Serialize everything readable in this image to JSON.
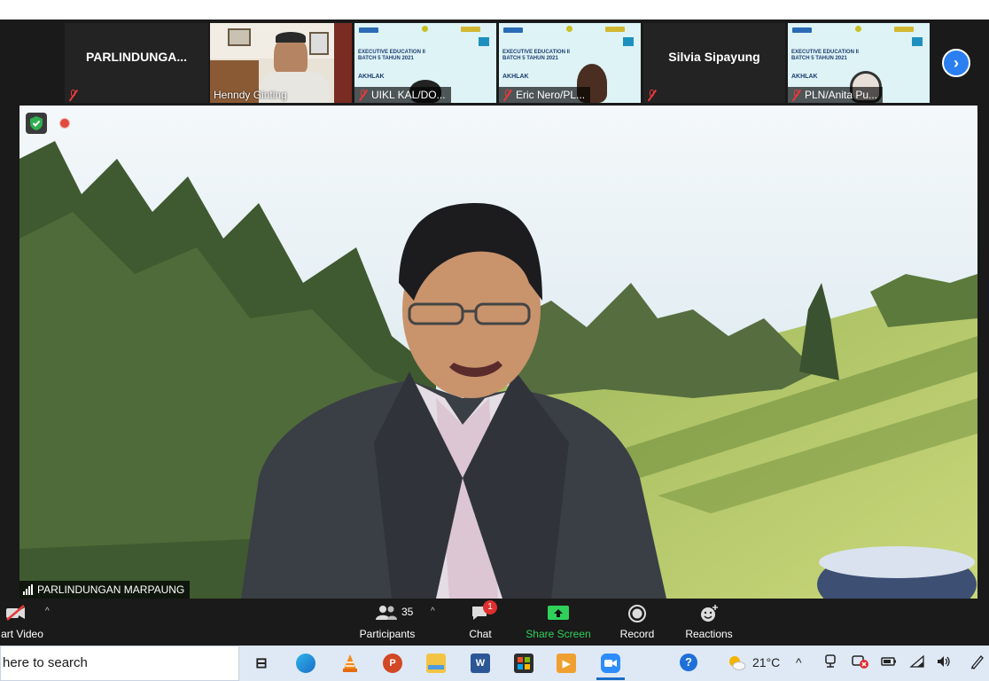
{
  "gallery": {
    "tiles": [
      {
        "name": "PARLINDUNGA...",
        "type": "name-only"
      },
      {
        "label": "Henndy Ginting",
        "type": "video"
      },
      {
        "label": "UIKL KAL/DO...",
        "type": "slide",
        "slide_title": "EXECUTIVE EDUCATION II\nBATCH 5 TAHUN 2021",
        "slide_word": "AKHLAK"
      },
      {
        "label": "Eric Nero/PL...",
        "type": "slide",
        "slide_title": "EXECUTIVE EDUCATION II\nBATCH 5 TAHUN 2021",
        "slide_word": "AKHLAK"
      },
      {
        "name": "Silvia Sipayung",
        "type": "name-only"
      },
      {
        "label": "PLN/Anita Pu...",
        "type": "slide",
        "slide_title": "EXECUTIVE EDUCATION II\nBATCH 5 TAHUN 2021",
        "slide_word": "AKHLAK"
      }
    ],
    "next_icon": "chevron-right-icon"
  },
  "main_video": {
    "speaker": "PARLINDUNGAN MARPAUNG",
    "security_icon": "shield-check-icon",
    "recording_icon": "record-dot-icon"
  },
  "toolbar": {
    "video_label": "art Video",
    "participants_label": "Participants",
    "participants_count": "35",
    "chat_label": "Chat",
    "chat_badge": "1",
    "share_label": "Share Screen",
    "record_label": "Record",
    "reactions_label": "Reactions",
    "colors": {
      "share": "#2fd15b",
      "badge": "#e02f2f",
      "video_off": "#e8393a"
    }
  },
  "taskbar": {
    "search_text": "here to search",
    "weather": "21°C",
    "apps": [
      "task-view-icon",
      "edge-icon",
      "vlc-icon",
      "powerpoint-icon",
      "file-explorer-icon",
      "word-icon",
      "store-icon",
      "media-player-icon",
      "zoom-icon"
    ],
    "tray_icons": [
      "help-icon",
      "weather-icon",
      "chevron-up-icon",
      "meet-icon",
      "blocked-icon",
      "battery-icon",
      "wifi-icon",
      "volume-icon",
      "pen-icon"
    ]
  }
}
